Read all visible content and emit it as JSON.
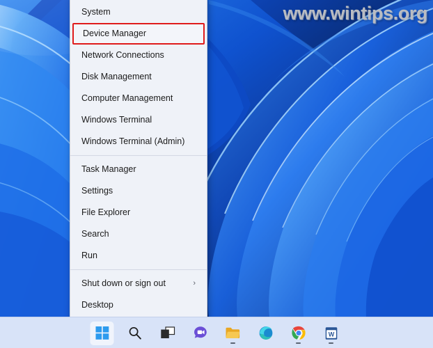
{
  "desktop": {
    "wallpaper_name": "windows-11-bloom-wallpaper",
    "colors": {
      "deep_blue": "#07225f",
      "mid_blue": "#0d46b8",
      "bright_blue": "#2a7ef0",
      "light_blue": "#56a8f7",
      "pale_blue": "#9fd0fb"
    }
  },
  "watermark": {
    "text": "www.wintips.org",
    "color": "#b9bcc2"
  },
  "winx_menu": {
    "name": "win-x-quick-link-menu",
    "background_color": "#eff2f8",
    "highlight_color": "#e01b1b",
    "items": [
      {
        "label": "System",
        "highlighted": false,
        "has_submenu": false,
        "separator_before": false
      },
      {
        "label": "Device Manager",
        "highlighted": true,
        "has_submenu": false,
        "separator_before": false
      },
      {
        "label": "Network Connections",
        "highlighted": false,
        "has_submenu": false,
        "separator_before": false
      },
      {
        "label": "Disk Management",
        "highlighted": false,
        "has_submenu": false,
        "separator_before": false
      },
      {
        "label": "Computer Management",
        "highlighted": false,
        "has_submenu": false,
        "separator_before": false
      },
      {
        "label": "Windows Terminal",
        "highlighted": false,
        "has_submenu": false,
        "separator_before": false
      },
      {
        "label": "Windows Terminal (Admin)",
        "highlighted": false,
        "has_submenu": false,
        "separator_before": false
      },
      {
        "label": "Task Manager",
        "highlighted": false,
        "has_submenu": false,
        "separator_before": true
      },
      {
        "label": "Settings",
        "highlighted": false,
        "has_submenu": false,
        "separator_before": false
      },
      {
        "label": "File Explorer",
        "highlighted": false,
        "has_submenu": false,
        "separator_before": false
      },
      {
        "label": "Search",
        "highlighted": false,
        "has_submenu": false,
        "separator_before": false
      },
      {
        "label": "Run",
        "highlighted": false,
        "has_submenu": false,
        "separator_before": false
      },
      {
        "label": "Shut down or sign out",
        "highlighted": false,
        "has_submenu": true,
        "separator_before": true
      },
      {
        "label": "Desktop",
        "highlighted": false,
        "has_submenu": false,
        "separator_before": false
      }
    ],
    "submenu_chevron": "›"
  },
  "taskbar": {
    "background_color": "#d8e3f8",
    "items": [
      {
        "icon": "windows-start-icon",
        "label": "Start",
        "active": true,
        "running": false
      },
      {
        "icon": "search-icon",
        "label": "Search",
        "active": false,
        "running": false
      },
      {
        "icon": "task-view-icon",
        "label": "Task View",
        "active": false,
        "running": false
      },
      {
        "icon": "chat-icon",
        "label": "Chat",
        "active": false,
        "running": false
      },
      {
        "icon": "file-explorer-icon",
        "label": "File Explorer",
        "active": false,
        "running": true
      },
      {
        "icon": "microsoft-edge-icon",
        "label": "Microsoft Edge",
        "active": false,
        "running": false
      },
      {
        "icon": "google-chrome-icon",
        "label": "Google Chrome",
        "active": false,
        "running": true
      },
      {
        "icon": "microsoft-word-icon",
        "label": "Microsoft Word",
        "active": false,
        "running": true
      }
    ]
  }
}
